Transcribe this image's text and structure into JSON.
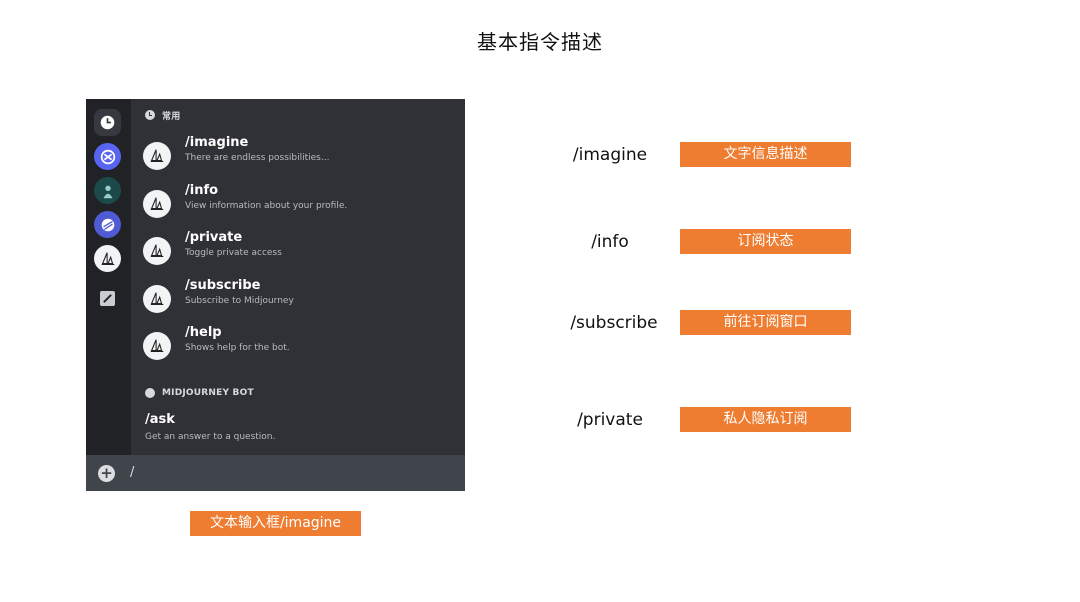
{
  "page": {
    "title": "基本指令描述"
  },
  "discord": {
    "section_common": "常用",
    "section_bot": "MIDJOURNEY BOT",
    "commands": [
      {
        "name": "/imagine",
        "desc": "There are endless possibilities..."
      },
      {
        "name": "/info",
        "desc": "View information about your profile."
      },
      {
        "name": "/private",
        "desc": "Toggle private access"
      },
      {
        "name": "/subscribe",
        "desc": "Subscribe to Midjourney"
      },
      {
        "name": "/help",
        "desc": "Shows help for the bot."
      }
    ],
    "ask": {
      "name": "/ask",
      "desc": "Get an answer to a question."
    },
    "input_value": "/",
    "rail_icons": [
      "clock-icon",
      "server-icon",
      "server-icon",
      "server-icon",
      "midjourney-icon",
      "sticker-icon"
    ]
  },
  "input_caption": "文本输入框/imagine",
  "legend": [
    {
      "command": "/imagine",
      "meaning": "文字信息描述"
    },
    {
      "command": "/info",
      "meaning": "订阅状态"
    },
    {
      "command": "/subscribe",
      "meaning": "前往订阅窗口"
    },
    {
      "command": "/private",
      "meaning": "私人隐私订阅"
    }
  ],
  "colors": {
    "accent": "#ee7d31",
    "panel": "#2f3136",
    "rail": "#202225",
    "input": "#40444b"
  }
}
